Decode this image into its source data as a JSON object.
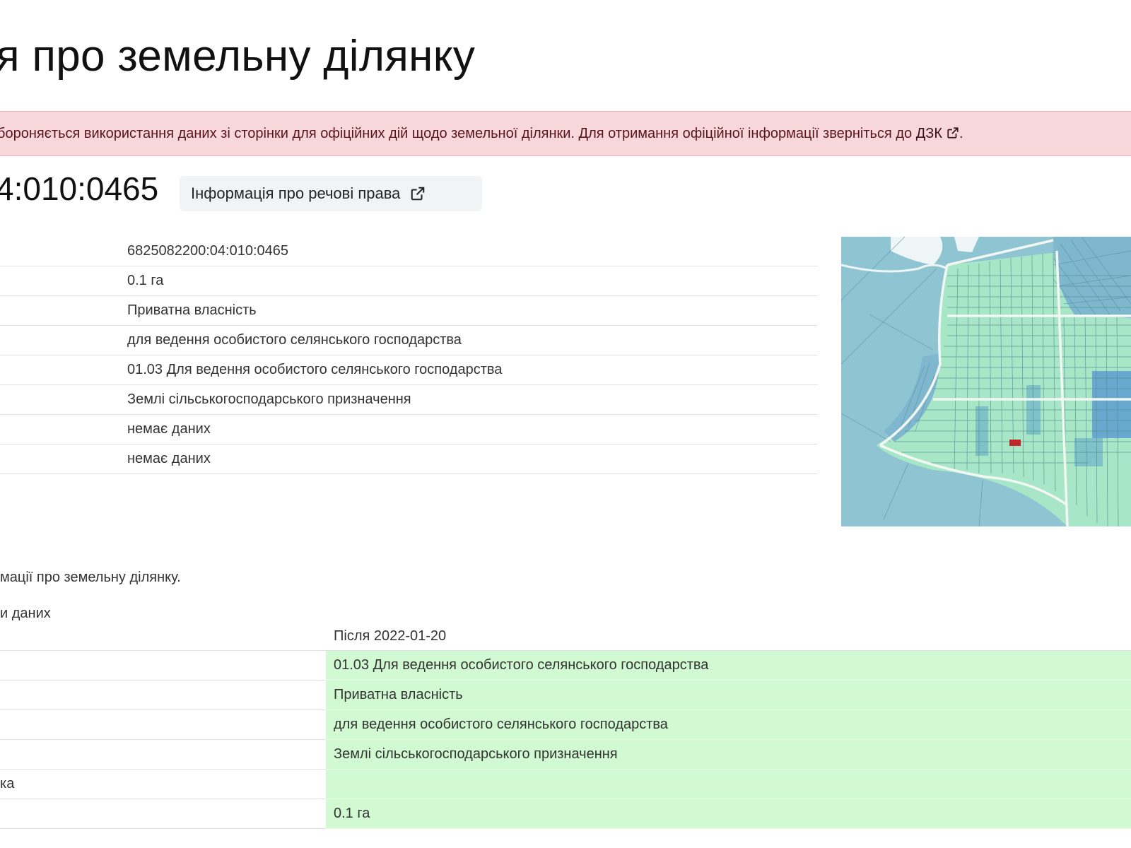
{
  "page": {
    "title": "я про земельну ділянку"
  },
  "alert": {
    "text": "бороняється використання даних зі сторінки для офіційних дій щодо земельної ділянки. Для отримання офіційної інформації зверніться до ",
    "link_label": "ДЗК",
    "suffix": "."
  },
  "parcel": {
    "cadnum_heading": "4:010:0465",
    "rights_button_label": "Інформація про речові права"
  },
  "info_rows": [
    {
      "value": "6825082200:04:010:0465"
    },
    {
      "value": "0.1 га"
    },
    {
      "value": "Приватна власність"
    },
    {
      "value": "для ведення особистого селянського господарства"
    },
    {
      "value": "01.03 Для ведення особистого селянського господарства"
    },
    {
      "value": "Землі сільськогосподарського призначення"
    },
    {
      "value": "немає даних"
    },
    {
      "value": "немає даних"
    }
  ],
  "note": "мації про земельну ділянку.",
  "changes": {
    "caption": "и даних",
    "header_after": "Після 2022-01-20",
    "rows": [
      {
        "label": "",
        "after": "01.03 Для ведення особистого селянського господарства"
      },
      {
        "label": "",
        "after": "Приватна власність"
      },
      {
        "label": "",
        "after": "для ведення особистого селянського господарства"
      },
      {
        "label": "",
        "after": "Землі сільськогосподарського призначення"
      },
      {
        "label": "ка",
        "after": ""
      },
      {
        "label": "",
        "after": "0.1 га"
      }
    ]
  },
  "colors": {
    "alert_bg": "#f8d7da",
    "changed_bg": "#d1fad2",
    "map_water": "#8fc5d2",
    "map_parcels": "#a8e6c8",
    "selected_parcel": "#c0282d"
  },
  "icons": {
    "external_link": "external-link-icon"
  }
}
